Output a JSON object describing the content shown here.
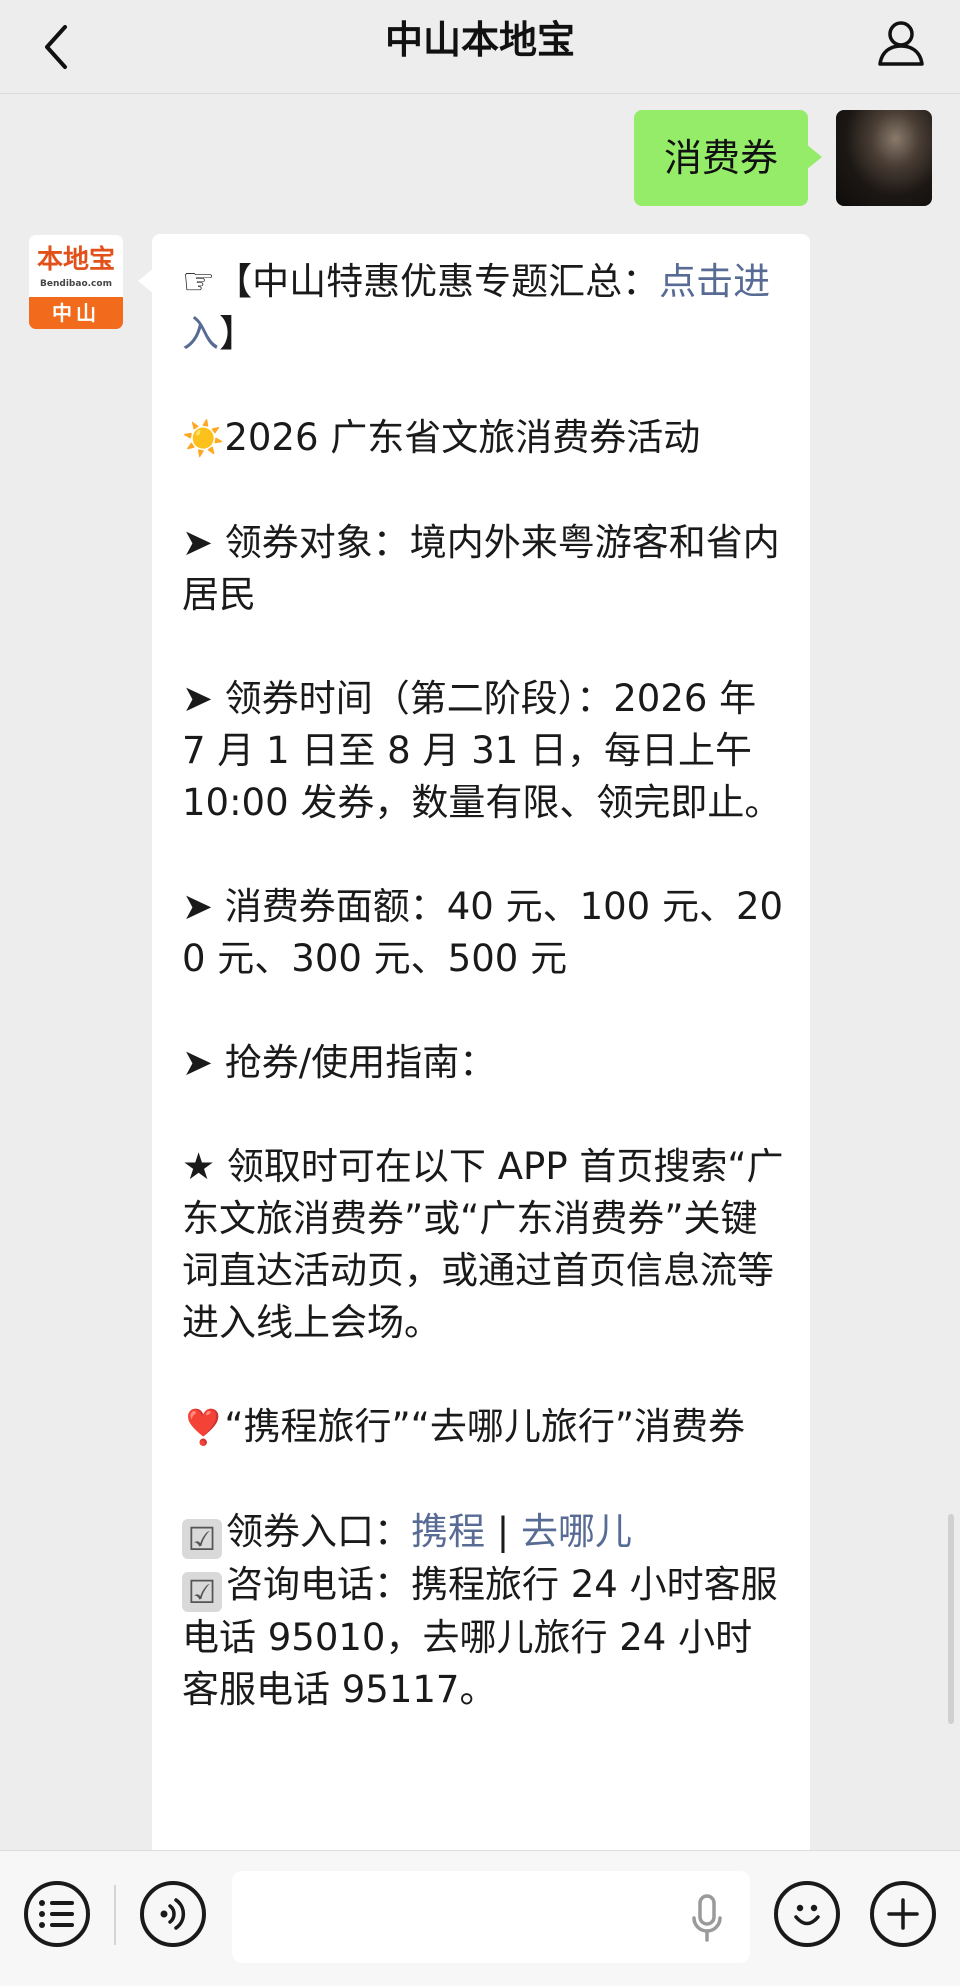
{
  "nav": {
    "title": "中山本地宝",
    "back_icon": "chevron-left-icon",
    "profile_icon": "person-icon"
  },
  "user_message": {
    "text": "消费券"
  },
  "bot": {
    "logo_text": "本地宝",
    "logo_url": "Bendibao.com",
    "logo_city": "中山"
  },
  "message": {
    "p1_prefix": "☞【中山特惠优惠专题汇总：",
    "p1_link": "点击进入",
    "p1_suffix": "】",
    "p2_icon": "☀️",
    "p2_text": "2026 广东省文旅消费券活动",
    "p3": "➤ 领券对象：境内外来粤游客和省内居民",
    "p4": "➤ 领券时间（第二阶段）：2026 年 7 月 1 日至 8 月 31 日，每日上午 10:00 发券，数量有限、领完即止。",
    "p5": "➤ 消费券面额：40 元、100 元、200 元、300 元、500 元",
    "p6": "➤ 抢券/使用指南：",
    "p7": "★ 领取时可在以下 APP 首页搜索“广东文旅消费券”或“广东消费券”关键词直达活动页，或通过首页信息流等进入线上会场。",
    "p8_icon": "❣️",
    "p8_text": "“携程旅行”“去哪儿旅行”消费券",
    "entry_label": "领券入口：",
    "entry_link1": "携程",
    "entry_sep": " | ",
    "entry_link2": "去哪儿",
    "phone_text": "咨询电话：携程旅行 24 小时客服电话 95010，去哪儿旅行 24 小时客服电话 95117。",
    "check_icon": "☑"
  },
  "input_bar": {
    "menu_icon": "list-menu-icon",
    "voice_icon": "voice-icon",
    "mic_icon": "microphone-icon",
    "emoji_icon": "smile-icon",
    "plus_icon": "plus-icon",
    "value": ""
  }
}
